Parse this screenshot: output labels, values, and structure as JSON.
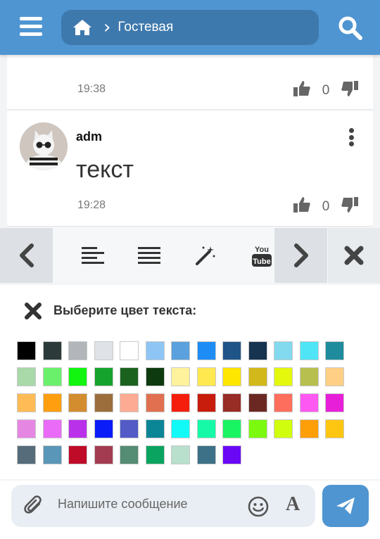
{
  "header": {
    "breadcrumb_title": "Гостевая",
    "brand_color": "#4f95d1"
  },
  "posts": [
    {
      "time": "19:38",
      "likes": "0"
    },
    {
      "author": "adm",
      "text": "текст",
      "time": "19:28",
      "likes": "0"
    }
  ],
  "toolbar": {
    "icons": [
      "chevron-left-icon",
      "align-left-icon",
      "align-justify-icon",
      "magic-wand-icon",
      "youtube-icon",
      "chevron-right-icon",
      "close-icon"
    ],
    "youtube_top": "You",
    "youtube_bottom": "Tube"
  },
  "color_panel": {
    "title": "Выберите цвет текста:",
    "colors": [
      "#000000",
      "#2d3a3a",
      "#b2b6ba",
      "#dfe3e8",
      "#ffffff",
      "#8ec5f5",
      "#5aa1dd",
      "#1e8cf5",
      "#1f5488",
      "#163350",
      "#83d9ee",
      "#4fe5f7",
      "#1e8c9c",
      "#a9d8a9",
      "#6bf06b",
      "#11f511",
      "#16a32d",
      "#1a621e",
      "#0e3a10",
      "#fff29c",
      "#ffe850",
      "#ffe600",
      "#d2b81a",
      "#e4f80d",
      "#b7c04e",
      "#ffcf85",
      "#ffbb55",
      "#ff9f0f",
      "#d38d2e",
      "#9c6e3c",
      "#fdab92",
      "#e0704f",
      "#f51e0d",
      "#c81c0d",
      "#972d25",
      "#6b2822",
      "#fd6e5c",
      "#fd58f2",
      "#e81fd8",
      "#e686e3",
      "#e96bf8",
      "#b932e9",
      "#0a1cf8",
      "#525bc6",
      "#0a8696",
      "#11faf8",
      "#16faa8",
      "#19f462",
      "#7bfa0f",
      "#d0fd0e",
      "#ff9f07",
      "#ffc611",
      "#566c7a",
      "#5996b7",
      "#bf0a28",
      "#a33c50",
      "#548c74",
      "#0aa460",
      "#b8e0cd",
      "#3c7187",
      "#6a08f6"
    ]
  },
  "composer": {
    "placeholder": "Напишите сообщение",
    "font_label": "A"
  }
}
